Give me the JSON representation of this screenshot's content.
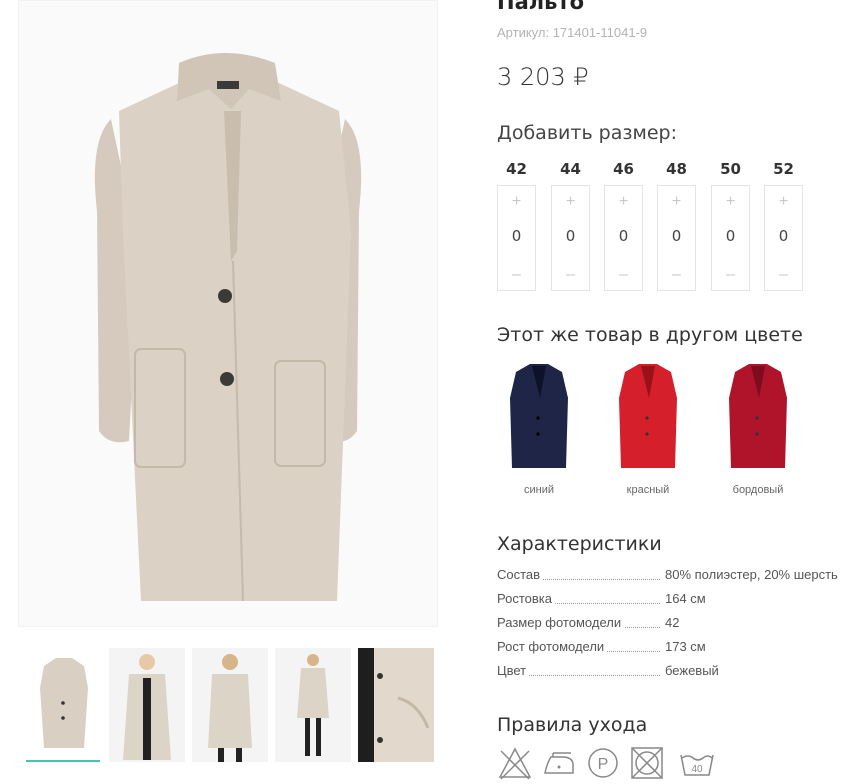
{
  "product": {
    "title": "Пальто",
    "sku_label": "Артикул:",
    "sku_value": "171401-11041-9",
    "price": "3 203 ₽"
  },
  "sizes": {
    "heading": "Добавить размер:",
    "items": [
      {
        "label": "42",
        "qty": "0"
      },
      {
        "label": "44",
        "qty": "0"
      },
      {
        "label": "46",
        "qty": "0"
      },
      {
        "label": "48",
        "qty": "0"
      },
      {
        "label": "50",
        "qty": "0"
      },
      {
        "label": "52",
        "qty": "0"
      }
    ],
    "plus": "+",
    "minus": "–"
  },
  "colors": {
    "heading": "Этот же товар в другом цвете",
    "items": [
      {
        "name": "синий",
        "hex": "#1f2547"
      },
      {
        "name": "красный",
        "hex": "#d5202b"
      },
      {
        "name": "бордовый",
        "hex": "#b0142b"
      }
    ]
  },
  "specs": {
    "heading": "Характеристики",
    "rows": [
      {
        "key": "Состав",
        "value": "80% полиэстер, 20% шерсть"
      },
      {
        "key": "Ростовка",
        "value": "164 см"
      },
      {
        "key": "Размер фотомодели",
        "value": "42"
      },
      {
        "key": "Рост фотомодели",
        "value": "173 см"
      },
      {
        "key": "Цвет",
        "value": "бежевый"
      }
    ]
  },
  "care": {
    "heading": "Правила ухода",
    "icons": [
      "no-tumble-dry-icon",
      "iron-low-icon",
      "dry-clean-p-icon",
      "no-tumble-dry-square-icon",
      "wash-40-icon"
    ],
    "wash_temp": "40"
  },
  "gallery": {
    "coat_color": "#d9cfc3",
    "accent": "#3fc7b3",
    "thumb_count": 5
  }
}
